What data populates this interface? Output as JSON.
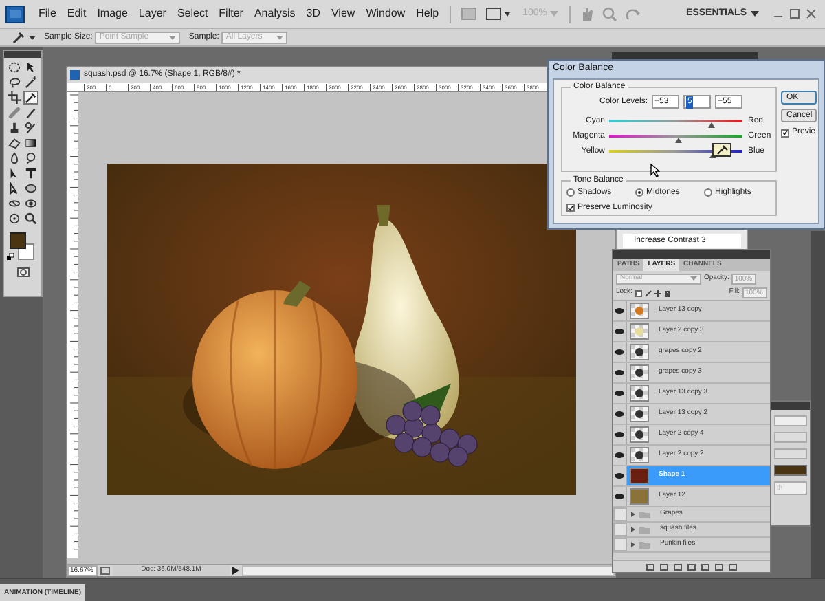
{
  "menu_bar": {
    "items": [
      "File",
      "Edit",
      "Image",
      "Layer",
      "Select",
      "Filter",
      "Analysis",
      "3D",
      "View",
      "Window",
      "Help"
    ],
    "zoom_level": "100%",
    "workspace": "ESSENTIALS"
  },
  "options_bar": {
    "sample_size_label": "Sample Size:",
    "sample_size": "Point Sample",
    "sample_label": "Sample:",
    "sample": "All Layers"
  },
  "toolbox": {
    "tools": [
      {
        "selected": false
      },
      {
        "selected": false
      },
      {
        "selected": false
      },
      {
        "selected": false
      },
      {
        "selected": false
      },
      {
        "selected": true
      },
      {
        "selected": false
      },
      {
        "selected": false
      },
      {
        "selected": false
      },
      {
        "selected": false
      },
      {
        "selected": false
      },
      {
        "selected": false
      },
      {
        "selected": false
      },
      {
        "selected": false
      },
      {
        "selected": false
      },
      {
        "selected": false
      },
      {
        "selected": false
      },
      {
        "selected": false
      },
      {
        "selected": false
      },
      {
        "selected": false
      },
      {
        "selected": false
      },
      {
        "selected": false
      }
    ]
  },
  "document": {
    "title": "squash.psd @ 16.7% (Shape 1, RGB/8#) *",
    "ruler_labels": [
      "200",
      "0",
      "200",
      "400",
      "600",
      "800",
      "1000",
      "1200",
      "1400",
      "1600",
      "1800",
      "2000",
      "2200",
      "2400",
      "2600",
      "2800",
      "3000",
      "3200",
      "3400",
      "3600",
      "3800"
    ],
    "zoom": "16.67%",
    "doc_size": "Doc: 36.0M/548.1M"
  },
  "history_panel": {
    "item": "Increase Contrast 3"
  },
  "color_balance": {
    "title": "Color Balance",
    "group_label": "Color Balance",
    "levels_label": "Color Levels:",
    "levels": [
      {
        "value": "+53",
        "selected": false
      },
      {
        "value": "5",
        "selected": true
      },
      {
        "value": "+55",
        "selected": false
      }
    ],
    "sliders": [
      {
        "left": "Cyan",
        "right": "Red",
        "level": 0.765
      },
      {
        "left": "Magenta",
        "right": "Green",
        "level": 0.525
      },
      {
        "left": "Yellow",
        "right": "Blue",
        "level": 0.775
      }
    ],
    "tone_label": "Tone Balance",
    "tones": [
      {
        "label": "Shadows",
        "selected": false
      },
      {
        "label": "Midtones",
        "selected": true
      },
      {
        "label": "Highlights",
        "selected": false
      }
    ],
    "preserve": {
      "label": "Preserve Luminosity",
      "checked": true
    },
    "buttons": [
      "OK",
      "Cancel"
    ],
    "preview": {
      "label": "Previe",
      "checked": true
    }
  },
  "layers_panel": {
    "tabs": [
      {
        "label": "PATHS",
        "selected": false
      },
      {
        "label": "LAYERS",
        "selected": true
      },
      {
        "label": "CHANNELS",
        "selected": false
      }
    ],
    "blend_mode": "Normal",
    "opacity_label": "Opacity:",
    "opacity": "100%",
    "lock_label": "Lock:",
    "fill_label": "Fill:",
    "fill": "100%",
    "layers": [
      {
        "kind": "image",
        "name": "Layer 13 copy",
        "visible": true,
        "selected": false,
        "color": "#d4781e"
      },
      {
        "kind": "image",
        "name": "Layer 2 copy 3",
        "visible": true,
        "selected": false,
        "color": "#e8dc9a"
      },
      {
        "kind": "image",
        "name": "grapes copy 2",
        "visible": true,
        "selected": false,
        "color": "#333333"
      },
      {
        "kind": "image",
        "name": "grapes copy 3",
        "visible": true,
        "selected": false,
        "color": "#333333"
      },
      {
        "kind": "image",
        "name": "Layer 13 copy 3",
        "visible": true,
        "selected": false,
        "color": "#333333"
      },
      {
        "kind": "image",
        "name": "Layer 13 copy 2",
        "visible": true,
        "selected": false,
        "color": "#333333"
      },
      {
        "kind": "image",
        "name": "Layer 2 copy 4",
        "visible": true,
        "selected": false,
        "color": "#333333"
      },
      {
        "kind": "image",
        "name": "Layer 2 copy 2",
        "visible": true,
        "selected": false,
        "color": "#333333"
      },
      {
        "kind": "fill",
        "name": "Shape 1",
        "visible": true,
        "selected": true,
        "color": "#6a1f10"
      },
      {
        "kind": "fill",
        "name": "Layer 12",
        "visible": true,
        "selected": false,
        "color": "#8a7238"
      },
      {
        "kind": "group",
        "name": "Grapes",
        "visible": false,
        "selected": false
      },
      {
        "kind": "group",
        "name": "squash files",
        "visible": false,
        "selected": false
      },
      {
        "kind": "group",
        "name": "Punkin files",
        "visible": false,
        "selected": false
      }
    ]
  },
  "side_panel": {
    "field": "th"
  },
  "bottom_panel": {
    "tab": "ANIMATION (TIMELINE)"
  }
}
